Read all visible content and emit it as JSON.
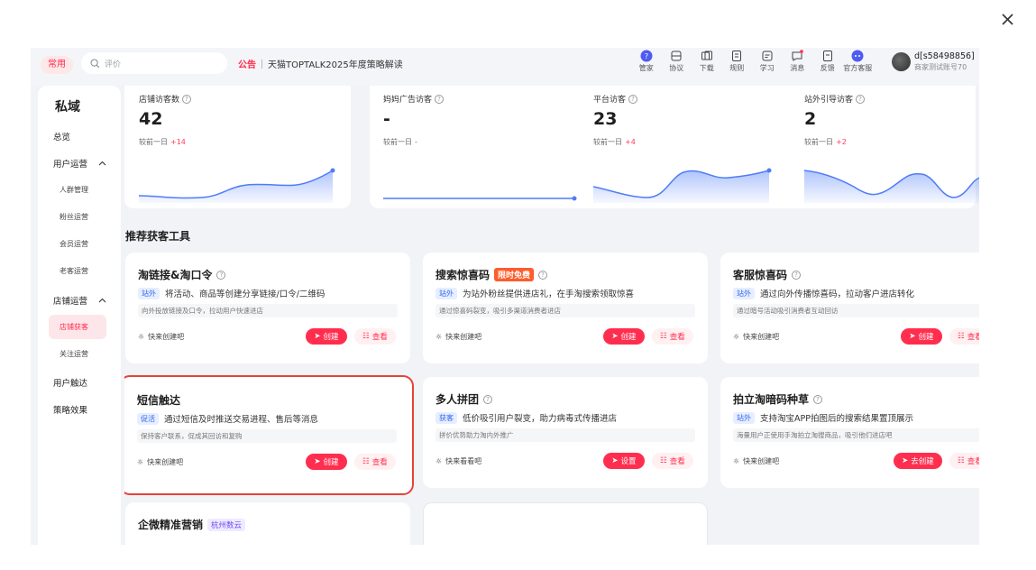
{
  "topbar": {
    "common_label": "常用",
    "search_placeholder": "评价",
    "notice_tag": "公告",
    "notice_text": "天猫TOPTALK2025年度策略解读",
    "tools": [
      {
        "label": "管家",
        "icon": "butler-icon"
      },
      {
        "label": "协议",
        "icon": "agreement-icon"
      },
      {
        "label": "下载",
        "icon": "download-icon"
      },
      {
        "label": "规则",
        "icon": "rules-icon"
      },
      {
        "label": "学习",
        "icon": "study-icon"
      },
      {
        "label": "消息",
        "icon": "message-icon"
      },
      {
        "label": "反馈",
        "icon": "feedback-icon"
      },
      {
        "label": "官方客服",
        "icon": "support-icon"
      }
    ],
    "user_name": "d[s58498856]",
    "user_sub": "商家测试账号70"
  },
  "sidebar": {
    "title": "私域",
    "items": {
      "overview": "总览",
      "user_ops": "用户运营",
      "crowd": "人群管理",
      "fans": "粉丝运营",
      "member": "会员运营",
      "old_customer": "老客运营",
      "store_ops": "店铺运营",
      "store_acquire": "店铺获客",
      "follow": "关注运营",
      "reach": "用户触达",
      "strategy": "策略效果"
    }
  },
  "stats": [
    {
      "label": "店铺访客数",
      "value": "42",
      "compare": "较前一日",
      "delta": "+14"
    },
    {
      "label": "妈妈广告访客",
      "value": "-",
      "compare": "较前一日",
      "delta": "-"
    },
    {
      "label": "平台访客",
      "value": "23",
      "compare": "较前一日",
      "delta": "+4"
    },
    {
      "label": "站外引导访客",
      "value": "2",
      "compare": "较前一日",
      "delta": "+2"
    }
  ],
  "section_title": "推荐获客工具",
  "tools": [
    {
      "title": "淘链接&淘口令",
      "tag": "站外",
      "desc": "将活动、商品等创建分享链接/口令/二维码",
      "sub": "向外投放链接及口令，拉动用户快速进店",
      "foot": "快来创建吧",
      "primary": "创建",
      "secondary": "查看"
    },
    {
      "title": "搜索惊喜码",
      "badge": "限时免费",
      "tag": "站外",
      "desc": "为站外粉丝提供进店礼，在手淘搜索领取惊喜",
      "sub": "通过惊喜码裂变，吸引多渠道消费者进店",
      "foot": "快来创建吧",
      "primary": "创建",
      "secondary": "查看"
    },
    {
      "title": "客服惊喜码",
      "tag": "站外",
      "desc": "通过向外传播惊喜码，拉动客户进店转化",
      "sub": "通过暗号活动吸引消费者互动回访",
      "foot": "快来创建吧",
      "primary": "创建",
      "secondary": "查看"
    },
    {
      "title": "短信触达",
      "tag": "促活",
      "desc": "通过短信及时推送交易进程、售后等消息",
      "sub": "保持客户联系，促成其回访和复购",
      "foot": "快来创建吧",
      "primary": "创建",
      "secondary": "查看"
    },
    {
      "title": "多人拼团",
      "tag": "获客",
      "desc": "低价吸引用户裂变，助力病毒式传播进店",
      "sub": "拼价优势助力淘内外推广",
      "foot": "快来看看吧",
      "primary": "设置",
      "secondary": "查看"
    },
    {
      "title": "拍立淘暗码种草",
      "tag": "站外",
      "desc": "支持淘宝APP拍图后的搜索结果置顶展示",
      "sub": "海量用户正使用手淘拍立淘搜商品，吸引他们进店吧",
      "foot": "快来创建吧",
      "primary": "去创建",
      "secondary": "查看"
    },
    {
      "title": "企微精准营销",
      "badge": "杭州数云"
    }
  ],
  "colors": {
    "accent": "#ff2e4f",
    "selection": "#e8413a",
    "chart": "#4f7cf7"
  },
  "selected_tool": "短信触达"
}
